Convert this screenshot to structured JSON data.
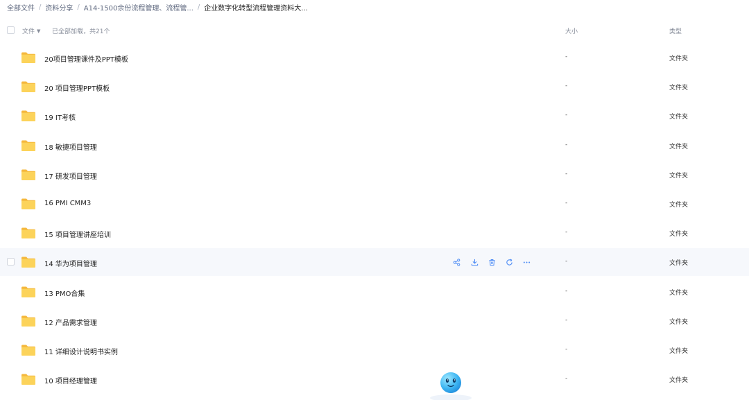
{
  "breadcrumb": [
    {
      "label": "全部文件"
    },
    {
      "label": "资料分享"
    },
    {
      "label": "A14-1500余份流程管理、流程管..."
    },
    {
      "label": "企业数字化转型流程管理资料大..."
    }
  ],
  "header": {
    "file_label": "文件",
    "loaded_status": "已全部加载，共21个",
    "size_label": "大小",
    "type_label": "类型"
  },
  "files": [
    {
      "name": "20项目管理课件及PPT模板",
      "size": "-",
      "type": "文件夹"
    },
    {
      "name": "20 项目管理PPT模板",
      "size": "-",
      "type": "文件夹"
    },
    {
      "name": "19 IT考核",
      "size": "-",
      "type": "文件夹"
    },
    {
      "name": "18 敏捷项目管理",
      "size": "-",
      "type": "文件夹"
    },
    {
      "name": "17 研发项目管理",
      "size": "-",
      "type": "文件夹"
    },
    {
      "name": "16 PMI CMM3",
      "size": "-",
      "type": "文件夹"
    },
    {
      "name": "15 项目管理讲座培训",
      "size": "-",
      "type": "文件夹"
    },
    {
      "name": "14 华为项目管理",
      "size": "-",
      "type": "文件夹"
    },
    {
      "name": "13 PMO合集",
      "size": "-",
      "type": "文件夹"
    },
    {
      "name": "12 产品需求管理",
      "size": "-",
      "type": "文件夹"
    },
    {
      "name": "11 详细设计说明书实例",
      "size": "-",
      "type": "文件夹"
    },
    {
      "name": "10 项目经理管理",
      "size": "-",
      "type": "文件夹"
    }
  ],
  "hover_row_index": 7,
  "row_actions": [
    "share-icon",
    "download-icon",
    "delete-icon",
    "refresh-icon",
    "more-icon"
  ],
  "colors": {
    "accent": "#4d8cf5",
    "folder": "#f9c94a",
    "hover_bg": "#f6f8fc"
  }
}
